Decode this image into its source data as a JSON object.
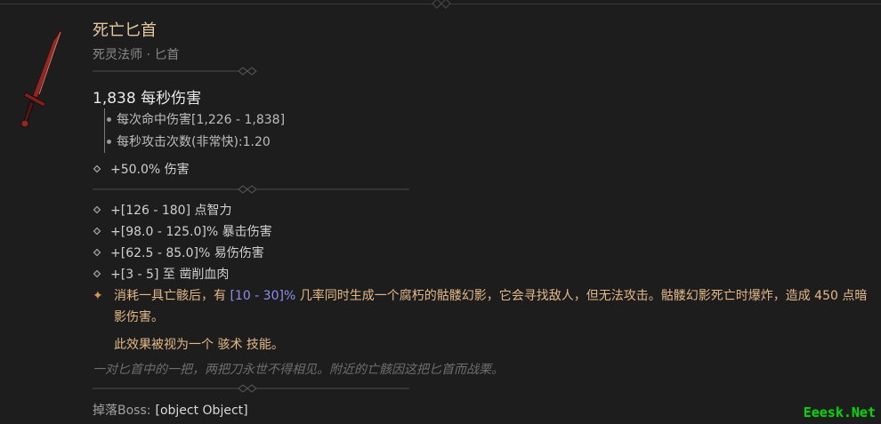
{
  "item": {
    "name": "死亡匕首",
    "type_line": "死灵法师 · 匕首",
    "dps": "1,838 每秒伤害",
    "damage_per_hit": "每次命中伤害[1,226 - 1,838]",
    "attack_speed": "每秒攻击次数(非常快):1.20",
    "implicit": "+50.0% 伤害",
    "affixes": [
      "+[126 - 180] 点智力",
      "+[98.0 - 125.0]% 暴击伤害",
      "+[62.5 - 85.0]% 易伤伤害",
      "+[3 - 5] 至 凿削血肉"
    ],
    "legendary": {
      "before": "消耗一具亡骸后，有 ",
      "range": "[10 - 30]%",
      "after": " 几率同时生成一个腐朽的骷髅幻影，它会寻找敌人，但无法攻击。骷髅幻影死亡时爆炸，造成 450 点暗影伤害。",
      "note": "此效果被视为一个 骇术 技能。"
    },
    "flavor": "一对匕首中的一把，两把刀永世不得相见。附近的亡骸因这把匕首而战栗。",
    "drop_label": "掉落Boss:",
    "drop_value": "[object Object]"
  },
  "watermark": "Eeesk.Net",
  "colors": {
    "title": "#e6c9a2",
    "legendary_text": "#e3b887",
    "range": "#8e8ef0",
    "watermark": "#18c818"
  },
  "icons": [
    "dagger-icon",
    "bullet-diamond-icon",
    "legendary-star-icon",
    "divider-ornament-icon"
  ]
}
